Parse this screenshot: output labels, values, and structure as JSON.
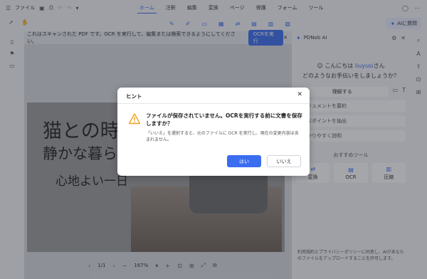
{
  "menubar": {
    "file_label": "ファイル",
    "menu_items": [
      "ホーム",
      "注釈",
      "編集",
      "変換",
      "ページ",
      "保護",
      "フォーム",
      "ツール"
    ],
    "active_index": 0
  },
  "toolbar": {
    "ai_button_label": "AIに質問"
  },
  "banner": {
    "message": "これはスキャンされた PDF です。OCR を実行して、編集または検索できるようにしてください。",
    "ocr_button": "OCRを実行"
  },
  "document": {
    "line1": "猫との時",
    "line2": "静かな暮ら",
    "line3": "心地よい一日",
    "page_indicator": "1/1",
    "zoom": "167%"
  },
  "right_panel": {
    "title": "PDNob AI",
    "greeting_prefix": "こんにちは",
    "user_name": "liuyusi",
    "greeting_suffix": "さん",
    "question": "どのようなお手伝いをしましょうか？",
    "understand_label": "理解する",
    "suggestions": [
      "ドキュメントを要約",
      "要なポイントを抽出",
      "わかりやすく説明"
    ],
    "recommended_title": "おすすめツール",
    "tools": [
      "変換",
      "OCR",
      "圧縮"
    ],
    "privacy_pre": "利用規約とプライバシーポリシーに同意し、AIがあなたのファイルをアップロードすることを許可します。",
    "privacy_link": "利用規約とプライバシーポリシー"
  },
  "modal": {
    "title": "ヒント",
    "heading": "ファイルが保存されていません。OCRを実行する前に文書を保存しますか？",
    "body": "「いいえ」を選択すると、元のファイルに OCR を実行し、現在の変更内容は含まれません。",
    "yes_label": "はい",
    "no_label": "いいえ"
  },
  "colors": {
    "accent": "#3a6df0",
    "warning": "#f0a020"
  }
}
